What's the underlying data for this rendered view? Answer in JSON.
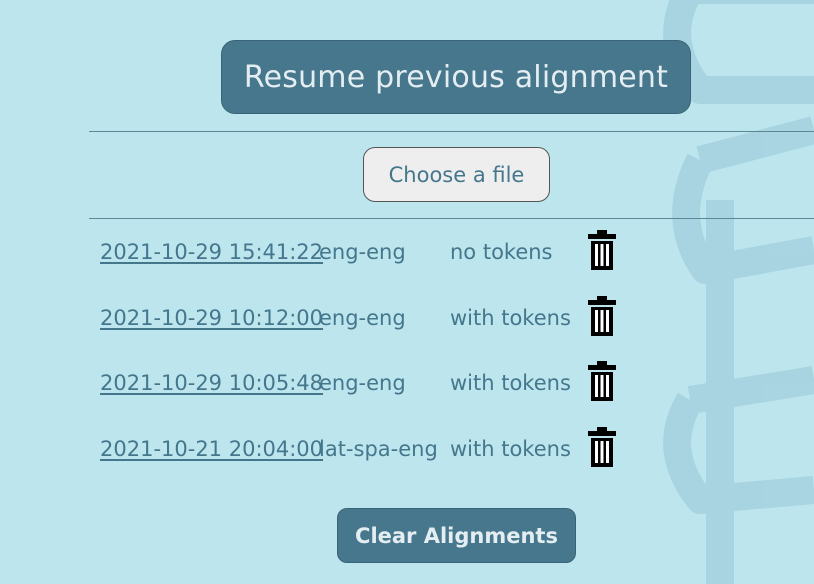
{
  "header": {
    "resume_label": "Resume previous alignment"
  },
  "file_picker": {
    "label": "Choose a file"
  },
  "alignments": [
    {
      "date": "2021-10-29 15:41:22",
      "languages": "eng-eng",
      "tokens": "no tokens"
    },
    {
      "date": "2021-10-29 10:12:00",
      "languages": "eng-eng",
      "tokens": "with tokens"
    },
    {
      "date": "2021-10-29 10:05:48",
      "languages": "eng-eng",
      "tokens": "with tokens"
    },
    {
      "date": "2021-10-21 20:04:00",
      "languages": "lat-spa-eng",
      "tokens": "with tokens"
    }
  ],
  "actions": {
    "clear_label": "Clear Alignments",
    "delete_icon": "trash-icon"
  },
  "colors": {
    "background": "#bde5ee",
    "primary": "#46778c",
    "text": "#44778c",
    "button_text": "#e4eef2",
    "file_button": "#eeeeee"
  }
}
